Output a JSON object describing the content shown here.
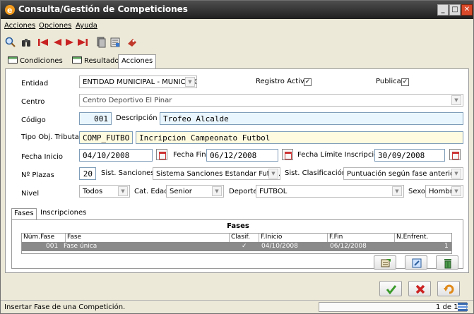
{
  "window": {
    "title": "Consulta/Gestión de Competiciones"
  },
  "menu": {
    "items": [
      "Acciones",
      "Opciones",
      "Ayuda"
    ]
  },
  "toolbar": {
    "icons": [
      "search-icon",
      "binoculars-icon",
      "first-record-icon",
      "previous-record-icon",
      "next-record-icon",
      "last-record-icon",
      "copy-icon",
      "report-icon",
      "bookmark-icon"
    ]
  },
  "tabs": [
    {
      "label": "Condiciones"
    },
    {
      "label": "Resultado"
    },
    {
      "label": "Acciones"
    }
  ],
  "form": {
    "entidad_label": "Entidad",
    "entidad_value": "ENTIDAD MUNICIPAL - MUNICIPIO",
    "registro_activo_label": "Registro Activo",
    "registro_activo_checked": "✓",
    "publicar_label": "Publicar",
    "publicar_checked": "✓",
    "centro_label": "Centro",
    "centro_value": "Centro Deportivo El Pinar",
    "codigo_label": "Código",
    "codigo_value": "001",
    "descripcion_label": "Descripción",
    "descripcion_value": "Trofeo Alcalde",
    "tipo_label": "Tipo Obj. Tributario",
    "tipo_code": "COMP_FUTBO",
    "tipo_desc": "Incripcion Campeonato Futbol",
    "fecha_inicio_label": "Fecha Inicio",
    "fecha_inicio_value": "04/10/2008",
    "fecha_fin_label": "Fecha Fin",
    "fecha_fin_value": "06/12/2008",
    "fecha_limite_label": "Fecha Límite Inscripción",
    "fecha_limite_value": "30/09/2008",
    "plazas_label": "Nº Plazas",
    "plazas_value": "20",
    "sanciones_label": "Sist. Sanciones",
    "sanciones_value": "Sistema Sanciones Estandar Futbo...",
    "clasificacion_label": "Sist. Clasificación",
    "clasificacion_value": "Puntuación según fase anterior",
    "nivel_label": "Nivel",
    "nivel_value": "Todos",
    "cat_edad_label": "Cat. Edad",
    "cat_edad_value": "Senior",
    "deporte_label": "Deporte",
    "deporte_value": "FUTBOL",
    "sexo_label": "Sexo",
    "sexo_value": "Hombre"
  },
  "subtabs": [
    {
      "label": "Fases"
    },
    {
      "label": "Inscripciones"
    }
  ],
  "fases_grid": {
    "title": "Fases",
    "columns": [
      "Núm.Fase",
      "Fase",
      "Clasif.",
      "F.Inicio",
      "F.Fin",
      "N.Enfrent."
    ],
    "rows": [
      {
        "num": "001",
        "fase": "Fase única",
        "clasif": "✓",
        "inicio": "04/10/2008",
        "fin": "06/12/2008",
        "enfrent": "1"
      }
    ]
  },
  "status": {
    "text": "Insertar Fase de una Competición.",
    "pager": "1 de 1"
  },
  "colors": {
    "titlebar": "#2b2b2b",
    "accent_red": "#cc2222",
    "accept_green": "#3a9a2a",
    "selected_row": "#8a8a8a"
  }
}
